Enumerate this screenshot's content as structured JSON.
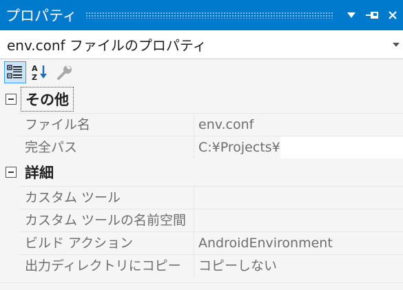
{
  "window": {
    "title": "プロパティ"
  },
  "object_selector": {
    "label": "env.conf ファイルのプロパティ"
  },
  "toolbar": {
    "buttons": [
      "categorized-icon",
      "alphabetical-icon",
      "property-pages-icon"
    ]
  },
  "categories": [
    {
      "label": "その他",
      "rows": [
        {
          "name": "ファイル名",
          "value": "env.conf"
        },
        {
          "name": "完全パス",
          "value": "C:¥Projects¥"
        }
      ]
    },
    {
      "label": "詳細",
      "rows": [
        {
          "name": "カスタム ツール",
          "value": ""
        },
        {
          "name": "カスタム ツールの名前空間",
          "value": ""
        },
        {
          "name": "ビルド アクション",
          "value": "AndroidEnvironment"
        },
        {
          "name": "出力ディレクトリにコピー",
          "value": "コピーしない"
        }
      ]
    }
  ],
  "colors": {
    "titlebar_bg": "#007acc",
    "panel_bg": "#f5f5f5",
    "selection_border": "#3399ff"
  }
}
